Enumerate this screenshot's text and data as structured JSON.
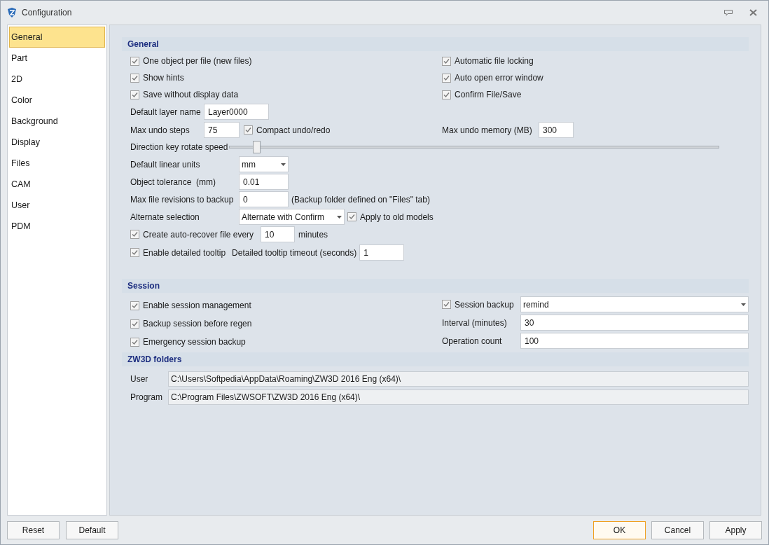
{
  "window": {
    "title": "Configuration"
  },
  "sidebar": {
    "items": [
      {
        "label": "General",
        "selected": true
      },
      {
        "label": "Part",
        "selected": false
      },
      {
        "label": "2D",
        "selected": false
      },
      {
        "label": "Color",
        "selected": false
      },
      {
        "label": "Background",
        "selected": false
      },
      {
        "label": "Display",
        "selected": false
      },
      {
        "label": "Files",
        "selected": false
      },
      {
        "label": "CAM",
        "selected": false
      },
      {
        "label": "User",
        "selected": false
      },
      {
        "label": "PDM",
        "selected": false
      }
    ]
  },
  "general": {
    "title": "General",
    "left_checks": [
      {
        "label": "One object per file (new files)",
        "checked": true
      },
      {
        "label": "Show hints",
        "checked": true
      },
      {
        "label": "Save without display data",
        "checked": true
      }
    ],
    "right_checks": [
      {
        "label": "Automatic file locking",
        "checked": true
      },
      {
        "label": "Auto open error window",
        "checked": true
      },
      {
        "label": "Confirm File/Save",
        "checked": true
      }
    ],
    "layer_name": {
      "label": "Default layer name",
      "value": "Layer0000"
    },
    "undo": {
      "label": "Max undo steps",
      "value": "75",
      "compact": {
        "label": "Compact undo/redo",
        "checked": true
      },
      "memory": {
        "label": "Max undo memory (MB)",
        "value": "300"
      }
    },
    "rotate_speed": {
      "label": "Direction key rotate speed",
      "level": 0.05
    },
    "linear_units": {
      "label": "Default linear units",
      "value": "mm"
    },
    "tolerance": {
      "label": "Object tolerance  (mm)",
      "value": "0.01"
    },
    "revisions": {
      "label": "Max file revisions to backup",
      "value": "0",
      "note": "(Backup folder defined on \"Files\" tab)"
    },
    "alternate": {
      "label": "Alternate selection",
      "value": "Alternate with Confirm",
      "apply": {
        "label": "Apply to old models",
        "checked": true
      }
    },
    "autorecover": {
      "label": "Create auto-recover file every",
      "checked": true,
      "value": "10",
      "unit": "minutes"
    },
    "tooltip": {
      "label": "Enable detailed tooltip",
      "checked": true,
      "timeout_label": "Detailed tooltip timeout (seconds)",
      "value": "1"
    }
  },
  "session": {
    "title": "Session",
    "left_checks": [
      {
        "label": "Enable session management",
        "checked": true
      },
      {
        "label": "Backup session before regen",
        "checked": true
      },
      {
        "label": "Emergency session backup",
        "checked": true
      }
    ],
    "backup": {
      "label": "Session backup",
      "checked": true,
      "value": "remind"
    },
    "interval": {
      "label": "Interval (minutes)",
      "value": "30"
    },
    "operation_count": {
      "label": "Operation count",
      "value": "100"
    }
  },
  "folders": {
    "title": "ZW3D folders",
    "rows": [
      {
        "label": "User",
        "value": "C:\\Users\\Softpedia\\AppData\\Roaming\\ZW3D 2016 Eng (x64)\\"
      },
      {
        "label": "Program",
        "value": "C:\\Program Files\\ZWSOFT\\ZW3D 2016 Eng (x64)\\"
      }
    ]
  },
  "buttons": {
    "left": [
      {
        "label": "Reset",
        "default": false
      },
      {
        "label": "Default",
        "default": false
      }
    ],
    "right": [
      {
        "label": "OK",
        "default": true
      },
      {
        "label": "Cancel",
        "default": false
      },
      {
        "label": "Apply",
        "default": false
      }
    ]
  }
}
